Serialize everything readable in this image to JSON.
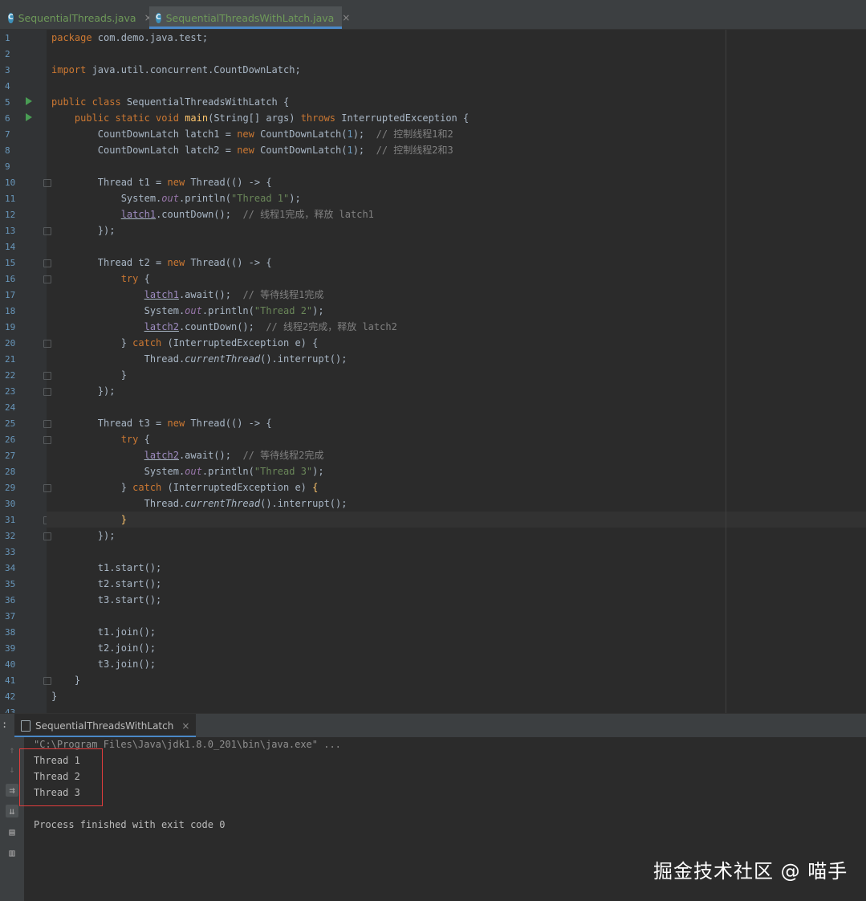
{
  "tabs": [
    {
      "label": "SequentialThreads.java",
      "close": "×"
    },
    {
      "label": "SequentialThreadsWithLatch.java",
      "close": "×"
    }
  ],
  "code_lines": [
    {
      "no": "1",
      "html": "<span class=\"kw\">package</span> com.demo.java.test;"
    },
    {
      "no": "2",
      "html": ""
    },
    {
      "no": "3",
      "html": "<span class=\"kw\">import</span> java.util.concurrent.CountDownLatch;"
    },
    {
      "no": "4",
      "html": ""
    },
    {
      "no": "5",
      "html": "<span class=\"kw\">public class</span> SequentialThreadsWithLatch {",
      "run": true
    },
    {
      "no": "6",
      "html": "    <span class=\"kw\">public static void</span> <span class=\"fn\">main</span>(String[] args) <span class=\"kw\">throws</span> InterruptedException {",
      "run": true
    },
    {
      "no": "7",
      "html": "        CountDownLatch latch1 = <span class=\"kw\">new</span> CountDownLatch(<span class=\"num\">1</span>);  <span class=\"cmt\">// 控制线程1和2</span>"
    },
    {
      "no": "8",
      "html": "        CountDownLatch latch2 = <span class=\"kw\">new</span> CountDownLatch(<span class=\"num\">1</span>);  <span class=\"cmt\">// 控制线程2和3</span>"
    },
    {
      "no": "9",
      "html": ""
    },
    {
      "no": "10",
      "html": "        Thread t1 = <span class=\"kw\">new</span> Thread(() -> {",
      "fold": true
    },
    {
      "no": "11",
      "html": "            System.<span class=\"it\">out</span>.println(<span class=\"str\">\"Thread 1\"</span>);"
    },
    {
      "no": "12",
      "html": "            <span class=\"ul\">latch1</span>.countDown();  <span class=\"cmt\">// 线程1完成，释放 latch1</span>"
    },
    {
      "no": "13",
      "html": "        });",
      "fold": true
    },
    {
      "no": "14",
      "html": ""
    },
    {
      "no": "15",
      "html": "        Thread t2 = <span class=\"kw\">new</span> Thread(() -> {",
      "fold": true
    },
    {
      "no": "16",
      "html": "            <span class=\"kw\">try</span> {",
      "fold": true
    },
    {
      "no": "17",
      "html": "                <span class=\"ul\">latch1</span>.await();  <span class=\"cmt\">// 等待线程1完成</span>"
    },
    {
      "no": "18",
      "html": "                System.<span class=\"it\">out</span>.println(<span class=\"str\">\"Thread 2\"</span>);"
    },
    {
      "no": "19",
      "html": "                <span class=\"ul\">latch2</span>.countDown();  <span class=\"cmt\">// 线程2完成，释放 latch2</span>"
    },
    {
      "no": "20",
      "html": "            } <span class=\"kw\">catch</span> (InterruptedException e) {",
      "fold": true
    },
    {
      "no": "21",
      "html": "                Thread.<span class=\"st\">currentThread</span>().interrupt();"
    },
    {
      "no": "22",
      "html": "            }",
      "fold": true
    },
    {
      "no": "23",
      "html": "        });",
      "fold": true
    },
    {
      "no": "24",
      "html": ""
    },
    {
      "no": "25",
      "html": "        Thread t3 = <span class=\"kw\">new</span> Thread(() -> {",
      "fold": true
    },
    {
      "no": "26",
      "html": "            <span class=\"kw\">try</span> {",
      "fold": true
    },
    {
      "no": "27",
      "html": "                <span class=\"ul\">latch2</span>.await();  <span class=\"cmt\">// 等待线程2完成</span>"
    },
    {
      "no": "28",
      "html": "                System.<span class=\"it\">out</span>.println(<span class=\"str\">\"Thread 3\"</span>);"
    },
    {
      "no": "29",
      "html": "            } <span class=\"kw\">catch</span> (InterruptedException e) <span class=\"fn\">{</span>",
      "fold": true
    },
    {
      "no": "30",
      "html": "                Thread.<span class=\"st\">currentThread</span>().interrupt();"
    },
    {
      "no": "31",
      "html": "            <span class=\"fn\">}</span>",
      "fold": true
    },
    {
      "no": "32",
      "html": "        });",
      "fold": true
    },
    {
      "no": "33",
      "html": ""
    },
    {
      "no": "34",
      "html": "        t1.start();"
    },
    {
      "no": "35",
      "html": "        t2.start();"
    },
    {
      "no": "36",
      "html": "        t3.start();"
    },
    {
      "no": "37",
      "html": ""
    },
    {
      "no": "38",
      "html": "        t1.join();"
    },
    {
      "no": "39",
      "html": "        t2.join();"
    },
    {
      "no": "40",
      "html": "        t3.join();"
    },
    {
      "no": "41",
      "html": "    }",
      "fold": true
    },
    {
      "no": "42",
      "html": "}"
    },
    {
      "no": "43",
      "html": ""
    }
  ],
  "run_panel": {
    "tab_label": "SequentialThreadsWithLatch",
    "tab_close": "×",
    "command": "\"C:\\Program Files\\Java\\jdk1.8.0_201\\bin\\java.exe\" ...",
    "output": [
      "Thread 1",
      "Thread 2",
      "Thread 3"
    ],
    "finished": "Process finished with exit code 0"
  },
  "watermark": "掘金技术社区 @ 喵手"
}
